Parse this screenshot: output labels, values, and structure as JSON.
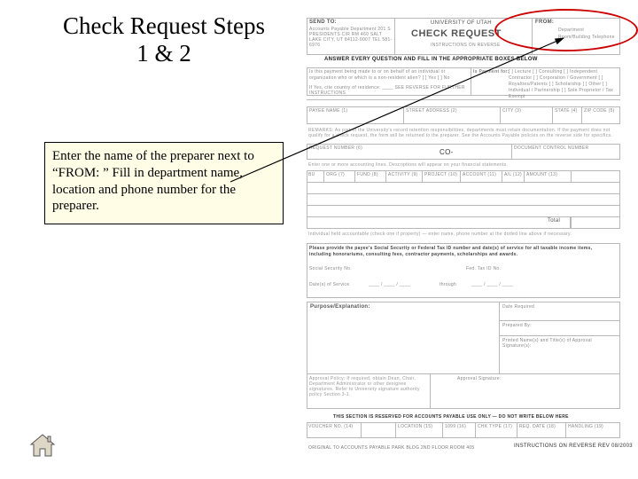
{
  "title": "Check Request Steps 1 & 2",
  "instruction": "Enter the name of the preparer next to “FROM: ”  Fill in department name, location and phone number for the preparer.",
  "form": {
    "header": {
      "send_to_label": "SEND TO:",
      "send_to_lines": "Accounts Payable Department\n201 S PRESIDENTS CIR RM 460\nSALT LAKE CITY, UT 84112-0007\nTEL 581-6976",
      "org": "UNIVERSITY OF UTAH",
      "title": "CHECK REQUEST",
      "subtitle": "INSTRUCTIONS ON REVERSE",
      "from_label": "FROM:",
      "from_lines": "Department\nRoom/Building\nTelephone",
      "bar": "ANSWER EVERY QUESTION AND FILL IN THE APPROPRIATE BOXES BELOW"
    },
    "q1": "Is this payment being made to or on behalf of an individual or organization who or which is a non-resident alien?  [ ] Yes  [ ] No",
    "q1_sub": "If Yes, cite country of residence: ____  SEE REVERSE FOR FURTHER INSTRUCTIONS",
    "payment_for": {
      "label": "Is Payment for:",
      "opts": "[ ] Lecture  [ ] Consulting  [ ] Independent Contractor  [ ] Corporation / Government\n[ ] Royalties/Patents  [ ] Scholarship  [ ] Other  [ ] Individual / Partnership\n  [ ] Sole Proprietor / Tax Exempt"
    },
    "payee_row": {
      "name": "PAYEE NAME (1)",
      "addr": "STREET ADDRESS (2)",
      "city": "CITY (3)",
      "state": "STATE (4)",
      "zip": "ZIP CODE (5)"
    },
    "remarks_note": "REMARKS: As part of the University's record retention responsibilities, departments must retain documentation. If the payment does not qualify for a check request, the form will be returned to the preparer. See the Accounts Payable policies on the reverse side for specifics.",
    "req_row": {
      "num": "REQUEST NUMBER (6)",
      "doc": "DOCUMENT CONTROL NUMBER"
    },
    "acct_note": "Enter one or more accounting lines. Descriptions will appear on your financial statements.",
    "acct_cols": {
      "bu": "BU",
      "org": "ORG (7)",
      "fund": "FUND (8)",
      "activity": "ACTIVITY (9)",
      "project": "PROJECT (10)",
      "acct": "ACCOUNT (11)",
      "aa": "A/L (12)",
      "amt": "AMOUNT (13)"
    },
    "co_value": "CO-",
    "total_label": "Total",
    "property_note": "Individual held accountable (check one if property) — enter name, phone number at the dotted line above if necessary.",
    "tax_block": "Please provide the payee's Social Security or Federal Tax ID number and date(s) of service for all taxable income items, including honorariums, consulting fees, contractor payments, scholarships and awards.",
    "ssn_label": "Social Security No.",
    "fedtax_label": "Fed. Tax ID No.",
    "dates_label": "Date(s) of Service",
    "dates_mid": "through",
    "purpose_label": "Purpose/Explanation:",
    "sig": {
      "date_req": "Date Required",
      "prepared_by": "Prepared By:",
      "printed": "Printed Name(s) and Title(s) of Approval Signature(s):",
      "policy_label": "Approval Policy: If required, obtain Dean, Chair, Department Administrator or other designee signatures. Refer to University signature authority policy Section 3-1.",
      "sig_label": "Approval Signature:"
    },
    "ap_bar": "THIS SECTION IS RESERVED FOR ACCOUNTS PAYABLE USE ONLY — DO NOT WRITE BELOW HERE",
    "ap_cols": {
      "vch": "VOUCHER NO. (14)",
      "vdate": "",
      "loc": "LOCATION (15)",
      "t1099": "1099 (16)",
      "ctype": "CHK TYPE (17)",
      "rdate": "REQ. DATE (18)",
      "hand": "HANDLING (19)"
    },
    "footer_left": "ORIGINAL TO ACCOUNTS PAYABLE  PARK BLDG 2ND FLOOR ROOM 405",
    "footer_right": "INSTRUCTIONS ON REVERSE  REV 08/2003"
  },
  "icons": {
    "home": "home-icon"
  }
}
